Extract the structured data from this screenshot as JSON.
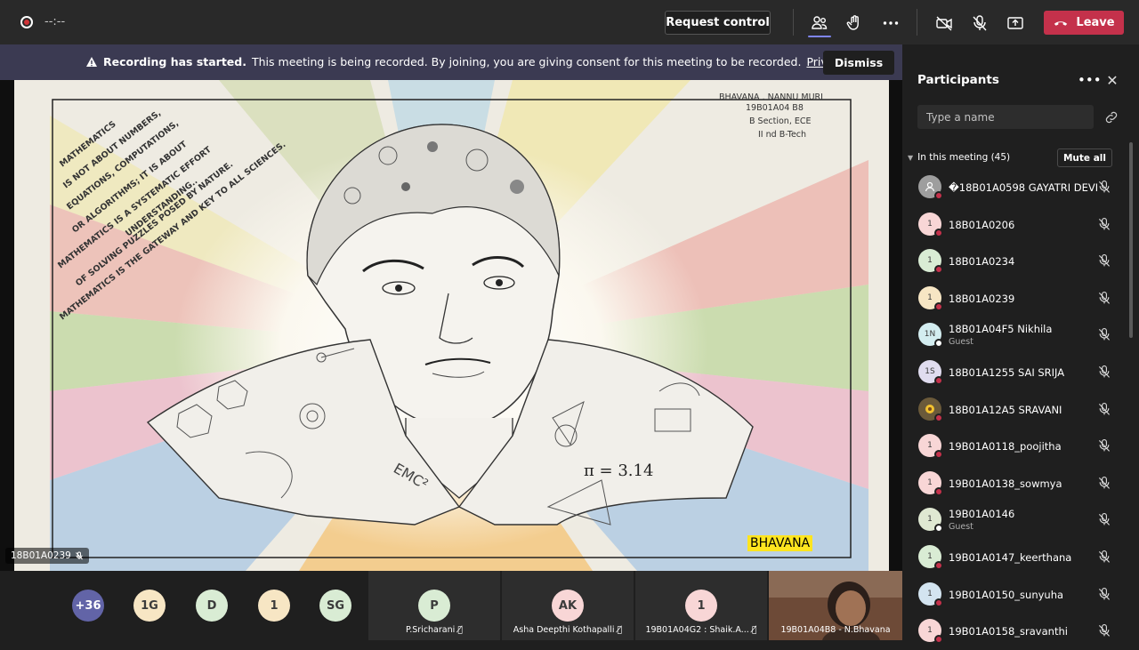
{
  "topbar": {
    "timer": "--:--",
    "request_control": "Request control",
    "leave": "Leave",
    "colors": {
      "leave": "#c4314b",
      "accent": "#7f85f5"
    }
  },
  "banner": {
    "bold": "Recording has started.",
    "text": "This meeting is being recorded. By joining, you are giving consent for this meeting to be recorded.",
    "link": "Privacy policy",
    "dismiss": "Dismiss"
  },
  "stage": {
    "presenter": "18B01A0239",
    "name_label": "BHAVANA",
    "drawing_text": {
      "header_1": "BHAVANA . NANNU MURI",
      "header_2": "19B01A04 B8",
      "header_3": "B Section, ECE",
      "header_4": "II nd B-Tech",
      "quote_1": "MATHEMATICS",
      "quote_2": "IS NOT ABOUT NUMBERS,",
      "quote_3": "EQUATIONS, COMPUTATIONS,",
      "quote_4": "OR ALGORITHMS; IT IS ABOUT",
      "quote_5": "UNDERSTANDING..",
      "quote_6": "MATHEMATICS IS A SYSTEMATIC EFFORT",
      "quote_7": "OF SOLVING PUZZLES POSED BY NATURE.",
      "quote_8": "MATHEMATICS IS THE GATEWAY AND KEY TO ALL SCIENCES.",
      "pi": "π = 3.14",
      "emc": "EMC²"
    }
  },
  "strip": {
    "overflow": "+36",
    "avatars": [
      "1G",
      "D",
      "1",
      "SG"
    ],
    "tiles": [
      {
        "initials": "P",
        "name": "P.Sricharani"
      },
      {
        "initials": "AK",
        "name": "Asha Deepthi Kothapalli"
      },
      {
        "initials": "1",
        "name": "19B01A04G2 : Shaik.A..."
      }
    ],
    "video_name": "19B01A04B8 - N.Bhavana"
  },
  "panel": {
    "title": "Participants",
    "search_placeholder": "Type a name",
    "section": "In this meeting (45)",
    "mute_all": "Mute all",
    "participants": [
      {
        "initials": "",
        "name": "�18B01A0598 GAYATRI DEVI",
        "sub": "",
        "color": "#9e9e9e"
      },
      {
        "initials": "1",
        "name": "18B01A0206",
        "sub": "",
        "color": "#f8d6d6"
      },
      {
        "initials": "1",
        "name": "18B01A0234",
        "sub": "",
        "color": "#d9ecd4"
      },
      {
        "initials": "1",
        "name": "18B01A0239",
        "sub": "",
        "color": "#f7e6c4"
      },
      {
        "initials": "1N",
        "name": "18B01A04F5 Nikhila",
        "sub": "Guest",
        "color": "#d3edf0"
      },
      {
        "initials": "1S",
        "name": "18B01A1255 SAI SRIJA",
        "sub": "",
        "color": "#e0dcef"
      },
      {
        "initials": "",
        "name": "18B01A12A5 SRAVANI",
        "sub": "",
        "color": "#6b5a3a"
      },
      {
        "initials": "1",
        "name": "19B01A0118_poojitha",
        "sub": "",
        "color": "#f8d6d6"
      },
      {
        "initials": "1",
        "name": "19B01A0138_sowmya",
        "sub": "",
        "color": "#f8d6d6"
      },
      {
        "initials": "1",
        "name": "19B01A0146",
        "sub": "Guest",
        "color": "#dfe8d2"
      },
      {
        "initials": "1",
        "name": "19B01A0147_keerthana",
        "sub": "",
        "color": "#d9ecd4"
      },
      {
        "initials": "1",
        "name": "19B01A0150_sunyuha",
        "sub": "",
        "color": "#d3e4f0"
      },
      {
        "initials": "1",
        "name": "19B01A0158_sravanthi",
        "sub": "",
        "color": "#f8d6d6"
      }
    ]
  }
}
